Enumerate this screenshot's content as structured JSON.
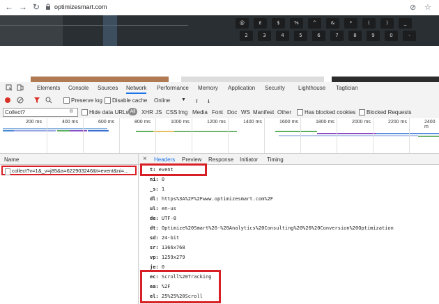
{
  "browser": {
    "url": "optimizesmart.com",
    "back_icon": "arrow-left-icon",
    "forward_icon": "arrow-right-icon",
    "reload_icon": "reload-icon"
  },
  "keyboard_keys": [
    "@",
    "£",
    "$",
    "%",
    "^",
    "&",
    "*",
    "(",
    ")",
    "_",
    "2",
    "3",
    "4",
    "5",
    "6",
    "7",
    "8",
    "9",
    "0",
    "-"
  ],
  "devtools": {
    "tabs": [
      "Elements",
      "Console",
      "Sources",
      "Network",
      "Performance",
      "Memory",
      "Application",
      "Security",
      "Lighthouse",
      "Tagtician"
    ],
    "active_tab": "Network",
    "toolbar": {
      "preserve_log": "Preserve log",
      "disable_cache": "Disable cache",
      "throttle": "Online"
    },
    "filter": {
      "value": "Collect?",
      "hide_data_urls": "Hide data URLs",
      "all": "All",
      "types": [
        "XHR",
        "JS",
        "CSS",
        "Img",
        "Media",
        "Font",
        "Doc",
        "WS",
        "Manifest",
        "Other"
      ],
      "has_blocked_cookies": "Has blocked cookies",
      "blocked_requests": "Blocked Requests"
    },
    "timeline_ticks": [
      "200 ms",
      "400 ms",
      "600 ms",
      "800 ms",
      "1000 ms",
      "1200 ms",
      "1400 ms",
      "1600 ms",
      "1800 ms",
      "2000 ms",
      "2200 ms",
      "2400 m"
    ],
    "name_header": "Name",
    "request": "collect?v=1&_v=j85&a=622903246&t=event&ni=...",
    "detail_tabs": [
      "Headers",
      "Preview",
      "Response",
      "Initiator",
      "Timing"
    ],
    "active_detail_tab": "Headers",
    "params": [
      {
        "k": "t:",
        "v": "event"
      },
      {
        "k": "ni:",
        "v": "0"
      },
      {
        "k": "_s:",
        "v": "1"
      },
      {
        "k": "dl:",
        "v": "https%3A%2F%2Fwww.optimizesmart.com%2F"
      },
      {
        "k": "ul:",
        "v": "en-us"
      },
      {
        "k": "de:",
        "v": "UTF-8"
      },
      {
        "k": "dt:",
        "v": "Optimize%20Smart%20-%20Analytics%20Consulting%20%26%20Conversion%20Optimization"
      },
      {
        "k": "sd:",
        "v": "24-bit"
      },
      {
        "k": "sr:",
        "v": "1366x768"
      },
      {
        "k": "vp:",
        "v": "1259x279"
      },
      {
        "k": "je:",
        "v": "0"
      },
      {
        "k": "ec:",
        "v": "Scroll%20Tracking"
      },
      {
        "k": "ea:",
        "v": "%2F"
      },
      {
        "k": "el:",
        "v": "25%25%20Scroll"
      }
    ]
  },
  "colors": {
    "highlight": "#d91f26",
    "accent": "#1a73e8",
    "record": "#d93025"
  }
}
